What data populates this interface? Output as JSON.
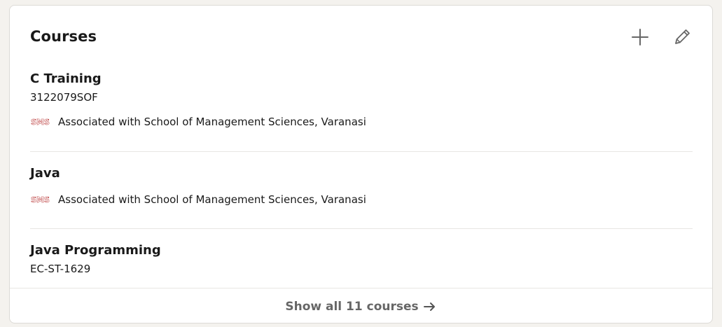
{
  "section": {
    "title": "Courses",
    "footer_label": "Show all 11 courses"
  },
  "courses": [
    {
      "title": "C Training",
      "number": "3122079SOF",
      "association": "Associated with School of Management Sciences, Varanasi",
      "logo_text": "SMS"
    },
    {
      "title": "Java",
      "association": "Associated with School of Management Sciences, Varanasi",
      "logo_text": "SMS"
    },
    {
      "title": "Java Programming",
      "number": "EC-ST-1629"
    }
  ],
  "icons": {
    "add": "plus-icon",
    "edit": "pencil-icon",
    "footer": "arrow-right-icon"
  },
  "colors": {
    "logo_red": "#b22222",
    "icon": "#666666"
  }
}
